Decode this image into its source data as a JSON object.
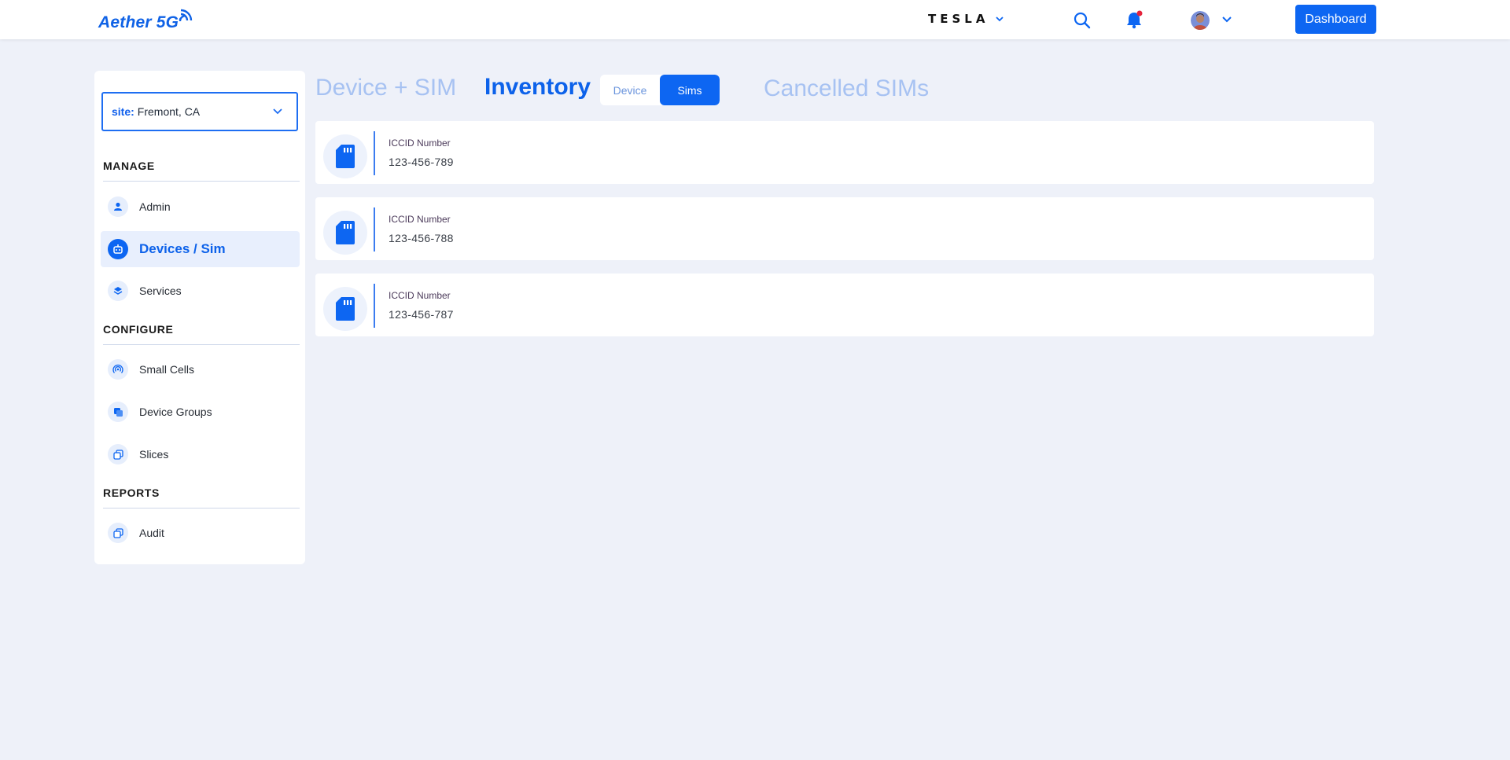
{
  "header": {
    "logo": "Aether 5G",
    "brand": "TESLA",
    "dashboard_label": "Dashboard"
  },
  "sidebar": {
    "site_key": "site:",
    "site_value": "Fremont, CA",
    "sections": {
      "manage": "MANAGE",
      "configure": "CONFIGURE",
      "reports": "REPORTS"
    },
    "items": [
      {
        "label": "Admin",
        "icon": "person-icon"
      },
      {
        "label": "Devices / Sim",
        "icon": "robot-icon",
        "active": true
      },
      {
        "label": "Services",
        "icon": "layers-icon"
      },
      {
        "label": "Small Cells",
        "icon": "wifi-signal-icon"
      },
      {
        "label": "Device Groups",
        "icon": "copy-icon"
      },
      {
        "label": "Slices",
        "icon": "stack-icon"
      },
      {
        "label": "Audit",
        "icon": "stack-icon"
      }
    ]
  },
  "main": {
    "tab_device_sim": "Device + SIM",
    "tab_inventory": "Inventory",
    "toggle": {
      "device": "Device",
      "sims": "Sims",
      "selected": "Sims"
    },
    "tab_cancelled": "Cancelled SIMs",
    "sims": [
      {
        "label": "ICCID Number",
        "value": "123-456-789"
      },
      {
        "label": "ICCID Number",
        "value": "123-456-788"
      },
      {
        "label": "ICCID Number",
        "value": "123-456-787"
      }
    ]
  },
  "colors": {
    "accent": "#0d66f2",
    "background": "#eef1f9",
    "muted_tab": "#a7c2f2",
    "notification_dot": "#e5233b"
  }
}
